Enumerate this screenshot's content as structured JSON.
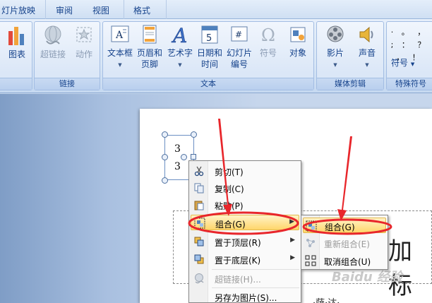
{
  "tabs": [
    {
      "label": "灯片放映"
    },
    {
      "label": "审阅"
    },
    {
      "label": "视图"
    },
    {
      "label": "格式"
    }
  ],
  "ribbon": {
    "chart": {
      "label": "图表"
    },
    "links_group": {
      "title": "链接",
      "hyperlink": "超链接",
      "action": "动作"
    },
    "text_group": {
      "title": "文本",
      "textbox": "文本框",
      "header_footer_1": "页眉和",
      "header_footer_2": "页脚",
      "wordart": "艺术字",
      "datetime_1": "日期和",
      "datetime_2": "时间",
      "slide_number_1": "幻灯片",
      "slide_number_2": "编号",
      "symbol": "符号",
      "object": "对象"
    },
    "media_group": {
      "title": "媒体剪辑",
      "movie": "影片",
      "sound": "声音"
    },
    "special_group": {
      "title": "特殊符号",
      "symbol": "符号",
      "glyphs": "· 。 ， ; ： ？ ， ！"
    }
  },
  "slide": {
    "selected_number_top": "3",
    "selected_number_bottom": "3",
    "placeholder_text": "加标",
    "bottom_text": "—·萨·达·"
  },
  "watermark": "Baidu 经验",
  "context_menu": {
    "items": [
      {
        "label": "剪切(T)",
        "disabled": false
      },
      {
        "label": "复制(C)",
        "disabled": false
      },
      {
        "label": "粘贴(P)",
        "disabled": false
      },
      {
        "label": "组合(G)",
        "disabled": false,
        "has_submenu": true,
        "highlighted": true
      },
      {
        "label": "置于顶层(R)",
        "disabled": false,
        "has_submenu": true
      },
      {
        "label": "置于底层(K)",
        "disabled": false,
        "has_submenu": true
      },
      {
        "label": "超链接(H)...",
        "disabled": true
      },
      {
        "label": "另存为图片(S)...",
        "disabled": false
      }
    ]
  },
  "submenu": {
    "items": [
      {
        "label": "组合(G)",
        "disabled": false,
        "highlighted": true
      },
      {
        "label": "重新组合(E)",
        "disabled": true
      },
      {
        "label": "取消组合(U)",
        "disabled": false
      }
    ]
  },
  "colors": {
    "annotation_red": "#e8262b",
    "highlight": "#ffd66b",
    "ribbon_text": "#15428b"
  }
}
